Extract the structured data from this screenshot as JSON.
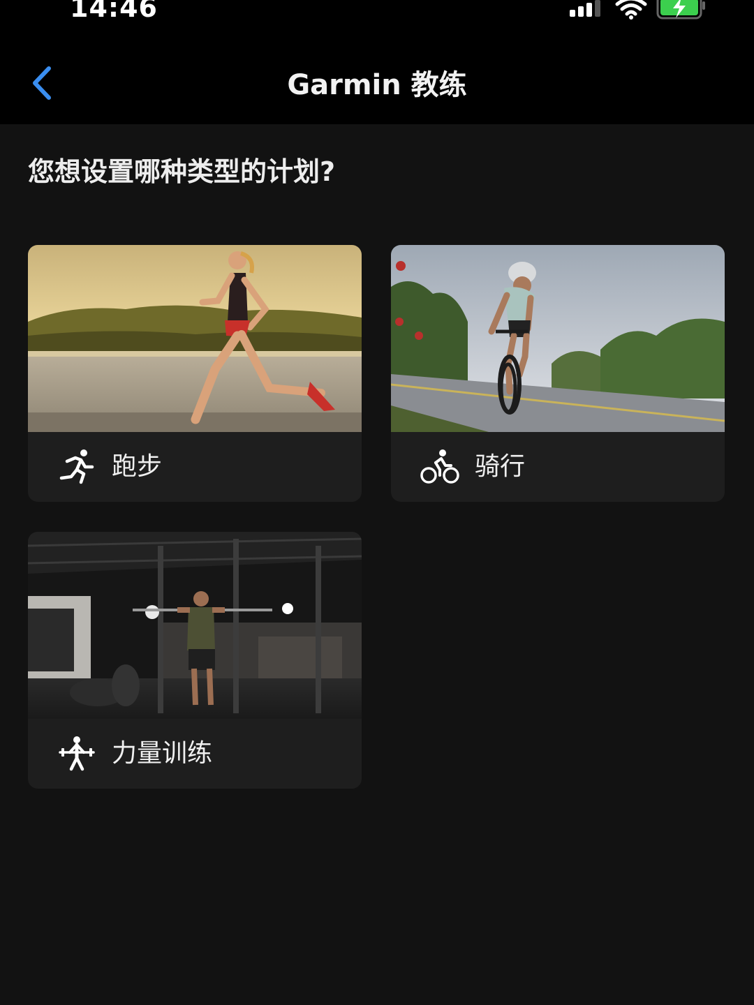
{
  "status_bar": {
    "time": "14:46",
    "signal_icon": "cellular-signal-icon",
    "wifi_icon": "wifi-icon",
    "battery_icon": "battery-charging-icon",
    "battery_color": "#3ccf4e"
  },
  "nav": {
    "back_icon": "chevron-left-icon",
    "title": "Garmin 教练",
    "accent_color": "#3a8ef0"
  },
  "question": "您想设置哪种类型的计划?",
  "plans": [
    {
      "label": "跑步",
      "icon": "running-icon",
      "image": "woman-running-photo"
    },
    {
      "label": "骑行",
      "icon": "cycling-icon",
      "image": "cyclist-road-photo"
    },
    {
      "label": "力量训练",
      "icon": "strength-training-icon",
      "image": "gym-barbell-photo"
    }
  ]
}
